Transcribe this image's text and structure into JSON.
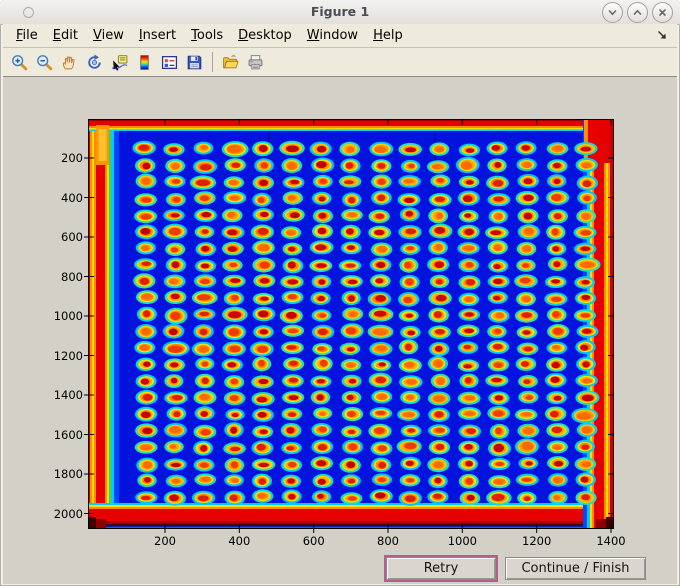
{
  "window": {
    "title": "Figure 1",
    "controls": [
      {
        "name": "minimize",
        "icon": "chevron-down-icon"
      },
      {
        "name": "maximize",
        "icon": "chevron-up-icon"
      },
      {
        "name": "close",
        "icon": "close-icon"
      }
    ]
  },
  "menu_bar": {
    "items": [
      "File",
      "Edit",
      "View",
      "Insert",
      "Tools",
      "Desktop",
      "Window",
      "Help"
    ],
    "dock_icon": "dock-arrow-icon"
  },
  "toolbar": {
    "tools": [
      "zoom-in",
      "zoom-out",
      "pan",
      "rotate-3d",
      "data-cursor",
      "colorbar",
      "insert-legend",
      "save",
      "separator",
      "open",
      "print"
    ]
  },
  "buttons": {
    "retry_label": "Retry",
    "continue_label": "Continue / Finish"
  },
  "colors": {
    "chrome_bg": "#eeebdc",
    "figure_bg": "#d3d0c7",
    "frame": "#f1efe9",
    "retry_focus_ring": "#b2608a",
    "heat_blue": "#0113dc",
    "heat_red": "#e60000",
    "halo_cyan": "#00d0f5",
    "ring_yellow": "#ffe100"
  },
  "chart_data": {
    "type": "heatmap",
    "title": "",
    "xlabel": "",
    "ylabel": "",
    "x_ticks": [
      200,
      400,
      600,
      800,
      1000,
      1200,
      1400
    ],
    "y_ticks": [
      200,
      400,
      600,
      800,
      1000,
      1200,
      1400,
      1600,
      1800,
      2000
    ],
    "xlim": [
      0,
      1410
    ],
    "ylim": [
      0,
      2075
    ],
    "y_direction": "down",
    "colormap": "jet",
    "grid_lines": false,
    "legend": false,
    "description": "Jet-colormap intensity image of a scanned plate/microarray: uniform deep-blue field, saturated red stripes with yellow-green-cyan fringes along all four edges, and a regular grid of spots, each spot a red-orange core inside a yellow ring with a cyan halo",
    "spot_grid": {
      "rows": 22,
      "cols": 16,
      "first_center": [
        148,
        154
      ],
      "step": [
        79,
        84
      ],
      "spot_radius_data": [
        27,
        33
      ]
    }
  }
}
